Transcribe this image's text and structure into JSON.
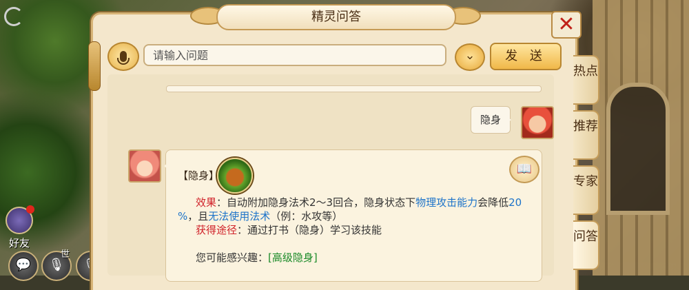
{
  "window": {
    "title": "精灵问答"
  },
  "input": {
    "placeholder": "请输入问题",
    "value": ""
  },
  "buttons": {
    "send_label": "发 送",
    "close_glyph": "✕",
    "dropdown_glyph": "⌄"
  },
  "conversation": {
    "user_message": "隐身",
    "reply": {
      "skill_name": "【隐身】",
      "effect_label": "效果",
      "effect_prefix": "：自动附加隐身法术2～3回合，隐身状态下",
      "effect_link1": "物理攻击能力",
      "effect_mid": "会降低",
      "effect_pct_a": "20",
      "effect_pct_b": "%",
      "effect_join": "，且",
      "effect_link2": "无法使用法术",
      "effect_suffix": "（例：水攻等）",
      "obtain_label": "获得途径",
      "obtain_text": "：通过打书（隐身）学习该技能",
      "interest_label": "您可能感兴趣：",
      "interest_link": "[高级隐身]"
    }
  },
  "side_tabs": [
    {
      "label": "热点"
    },
    {
      "label": "推荐"
    },
    {
      "label": "专家"
    },
    {
      "label": "问答",
      "active": true
    }
  ],
  "hud": {
    "friends_label": "好友",
    "world_label": "世"
  },
  "icons": [
    "microphone-icon",
    "chevron-down-icon",
    "close-icon",
    "book-icon",
    "chat-icon",
    "voice-icon",
    "back-icon"
  ],
  "colors": {
    "red": "#d0222a",
    "link_blue": "#1c73c9",
    "green": "#1a8a28",
    "panel": "#f4e7cc"
  }
}
